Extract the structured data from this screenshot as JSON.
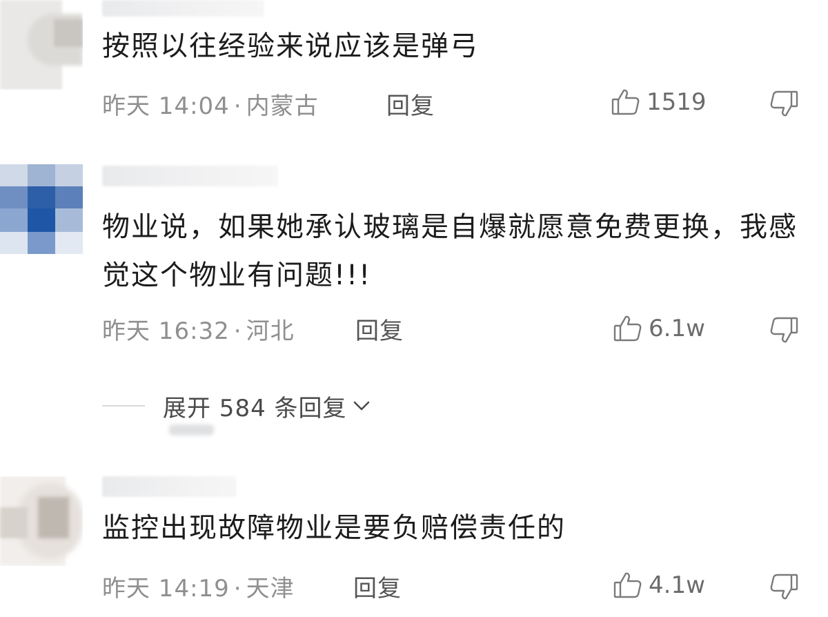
{
  "comments": [
    {
      "text": "按照以往经验来说应该是弹弓",
      "time": "昨天 14:04",
      "location": "内蒙古",
      "reply_label": "回复",
      "likes": "1519"
    },
    {
      "text": "物业说，如果她承认玻璃是自爆就愿意免费更换，我感觉这个物业有问题!!!",
      "time": "昨天 16:32",
      "location": "河北",
      "reply_label": "回复",
      "likes": "6.1w"
    },
    {
      "text": "监控出现故障物业是要负赔偿责任的",
      "time": "昨天 14:19",
      "location": "天津",
      "reply_label": "回复",
      "likes": "4.1w"
    }
  ],
  "expand_replies": {
    "label": "展开 584 条回复"
  },
  "meta_separator": "·",
  "icons": {
    "like": "thumbs-up-icon",
    "dislike": "thumbs-down-icon",
    "expand": "chevron-down-icon"
  },
  "colors": {
    "text": "#1c1c1c",
    "meta": "#8f8f8f",
    "reply": "#555555",
    "like": "#6b6b6b",
    "divider": "#d9d9d9"
  }
}
